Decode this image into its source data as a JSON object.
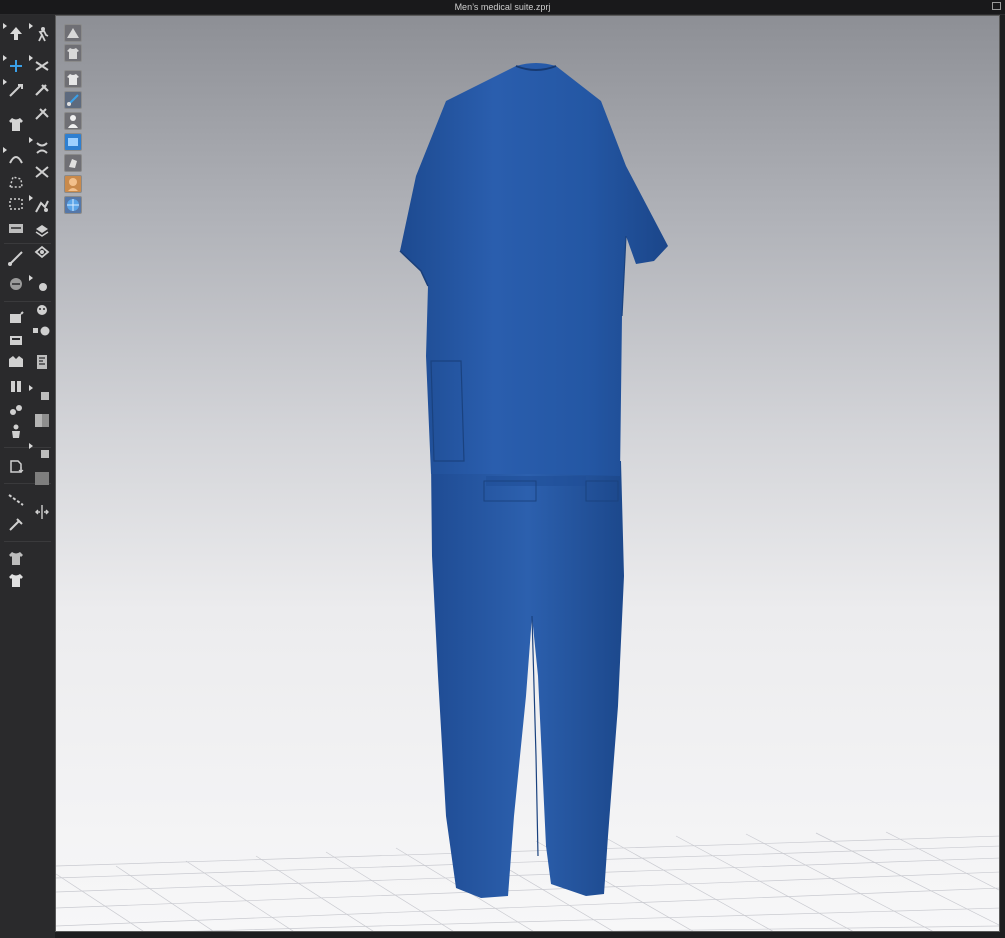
{
  "window": {
    "title": "Men’s medical suite.zprj"
  },
  "colors": {
    "garment": "#2457a4",
    "toolbar_bg": "#2a2a2c",
    "titlebar_bg": "#19191b",
    "viewport_top": "#8d8f95",
    "viewport_bottom": "#f7f7f8",
    "accent_select": "#3aa0e8"
  },
  "toolbar": {
    "left_column": [
      {
        "icon": "select-move-icon"
      },
      {
        "icon": "transform-gizmo-icon"
      },
      {
        "icon": "edit-pattern-icon"
      },
      {
        "icon": "garment-fit-icon"
      },
      {
        "icon": "edit-curvature-icon"
      },
      {
        "icon": "polygon-icon"
      },
      {
        "icon": "rectangle-icon"
      },
      {
        "icon": "internal-line-icon"
      },
      {
        "icon": "folding-icon"
      },
      {
        "icon": "seam-line-icon"
      },
      {
        "icon": "sewing-icon"
      },
      {
        "icon": "pin-icon"
      },
      {
        "icon": "tack-icon"
      },
      {
        "icon": "trim-icon"
      },
      {
        "icon": "button-icon"
      },
      {
        "icon": "avatar-measure-icon"
      },
      {
        "icon": "texture-edit-icon"
      },
      {
        "icon": "topstitch-icon"
      },
      {
        "icon": "fabric-icon"
      },
      {
        "icon": "layer-icon"
      }
    ],
    "right_column": [
      {
        "icon": "simulation-icon"
      },
      {
        "icon": "arrangement-icon"
      },
      {
        "icon": "fold-arrangement-icon"
      },
      {
        "icon": "strengthen-icon"
      },
      {
        "icon": "zipper-icon"
      },
      {
        "icon": "tape-icon"
      },
      {
        "icon": "elastic-icon"
      },
      {
        "icon": "puckering-icon"
      },
      {
        "icon": "shrinkage-icon"
      },
      {
        "icon": "graphic-icon"
      },
      {
        "icon": "button-hole-icon"
      },
      {
        "icon": "lock-button-icon"
      },
      {
        "icon": "measure-icon"
      },
      {
        "icon": "fabric-swatch-icon"
      },
      {
        "icon": "fabric-swatch-2-icon"
      },
      {
        "icon": "fabric-swatch-3-icon"
      },
      {
        "icon": "fabric-swatch-4-icon"
      },
      {
        "icon": "flip-normal-icon"
      }
    ]
  },
  "viewport": {
    "tools": [
      {
        "icon": "show-avatar-icon"
      },
      {
        "icon": "show-garment-icon"
      },
      {
        "icon": "pattern-pieces-icon"
      },
      {
        "icon": "strain-map-icon"
      },
      {
        "icon": "avatar-silhouette-icon"
      },
      {
        "icon": "texture-view-icon"
      },
      {
        "icon": "render-icon"
      },
      {
        "icon": "skin-tone-icon"
      },
      {
        "icon": "world-grid-icon"
      }
    ]
  }
}
